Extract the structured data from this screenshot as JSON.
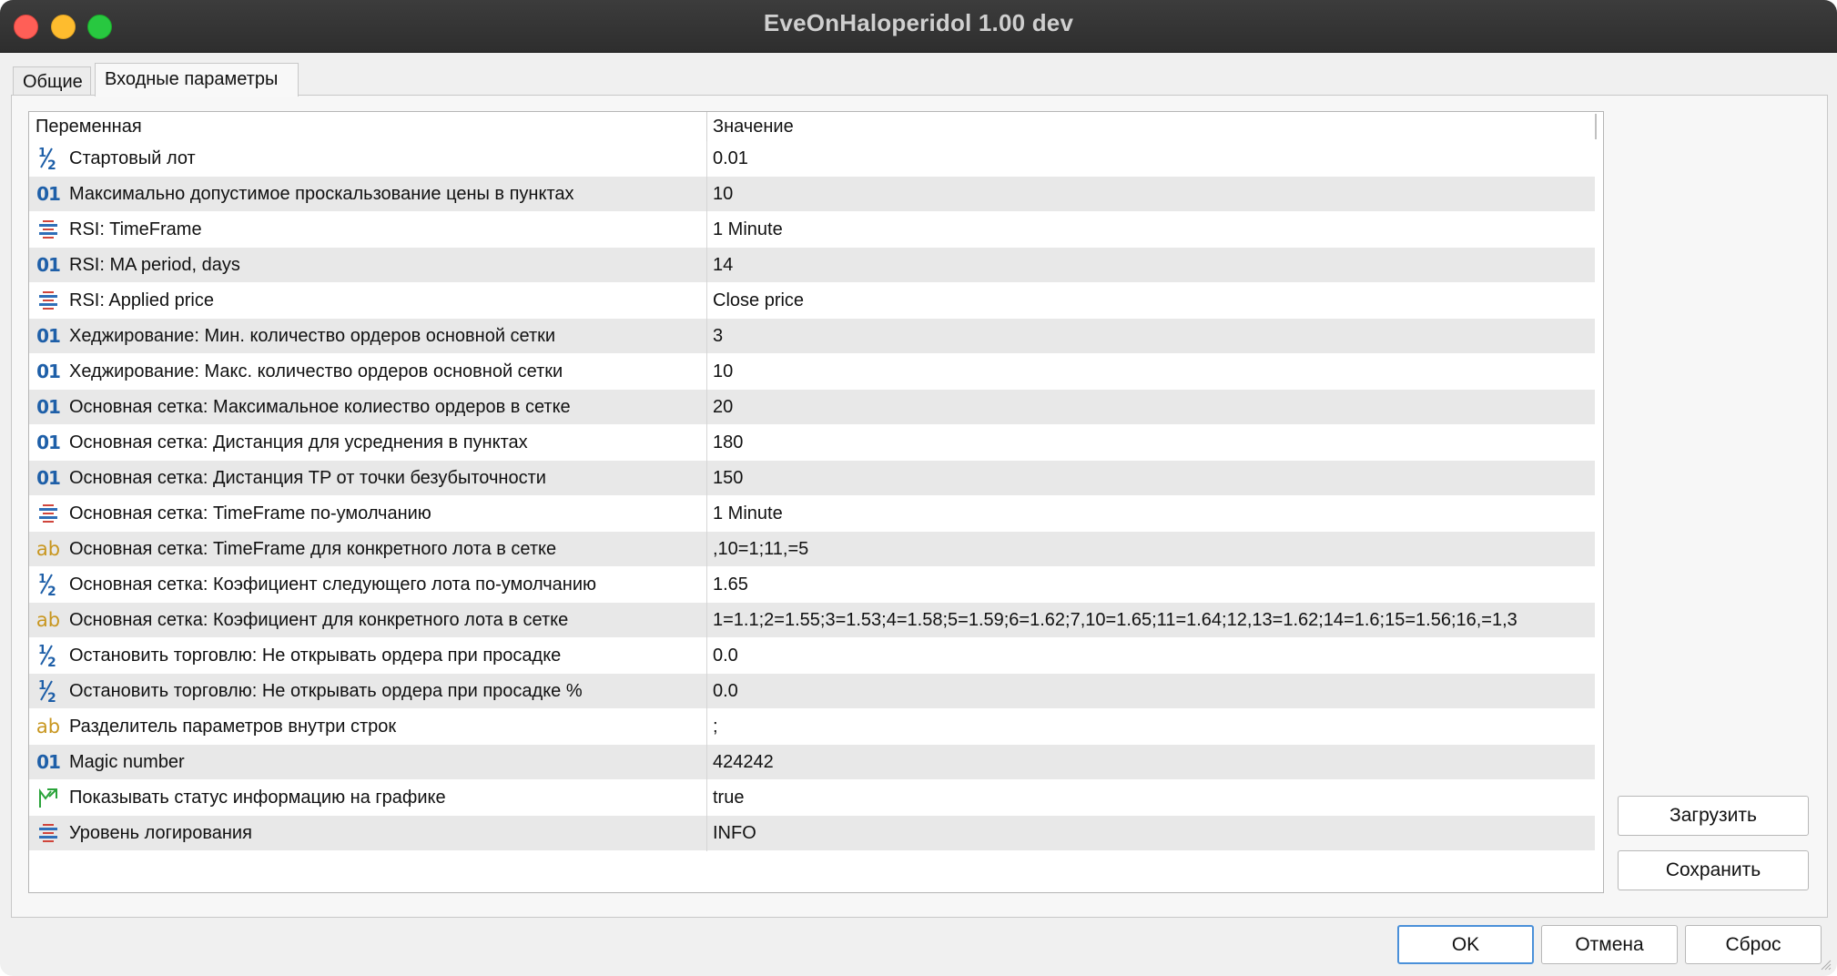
{
  "window": {
    "title": "EveOnHaloperidol 1.00 dev"
  },
  "tabs": [
    {
      "label": "Общие"
    },
    {
      "label": "Входные параметры"
    }
  ],
  "grid": {
    "header_variable": "Переменная",
    "header_value": "Значение",
    "rows": [
      {
        "icon": "fraction-icon",
        "name": "Стартовый лот",
        "value": "0.01"
      },
      {
        "icon": "integer-icon",
        "name": "Максимально допустимое проскальзование цены в пунктах",
        "value": "10"
      },
      {
        "icon": "enum-list-icon",
        "name": "RSI: TimeFrame",
        "value": "1 Minute"
      },
      {
        "icon": "integer-icon",
        "name": "RSI: MA period, days",
        "value": "14"
      },
      {
        "icon": "enum-list-icon",
        "name": "RSI: Applied price",
        "value": "Close price"
      },
      {
        "icon": "integer-icon",
        "name": "Хеджирование: Мин. количество ордеров основной сетки",
        "value": "3"
      },
      {
        "icon": "integer-icon",
        "name": "Хеджирование: Макс. количество ордеров основной сетки",
        "value": "10"
      },
      {
        "icon": "integer-icon",
        "name": "Основная сетка: Максимальное колиество ордеров в сетке",
        "value": "20"
      },
      {
        "icon": "integer-icon",
        "name": "Основная сетка: Дистанция для усреднения в пунктах",
        "value": "180"
      },
      {
        "icon": "integer-icon",
        "name": "Основная сетка: Дистанция TP от точки безубыточности",
        "value": "150"
      },
      {
        "icon": "enum-list-icon",
        "name": "Основная сетка: TimeFrame по-умолчанию",
        "value": "1 Minute"
      },
      {
        "icon": "string-icon",
        "name": "Основная сетка: TimeFrame для конкретного лота в сетке",
        "value": ",10=1;11,=5"
      },
      {
        "icon": "fraction-icon",
        "name": "Основная сетка: Коэфициент следующего лота по-умолчанию",
        "value": "1.65"
      },
      {
        "icon": "string-icon",
        "name": "Основная сетка: Коэфициент для конкретного лота в сетке",
        "value": "1=1.1;2=1.55;3=1.53;4=1.58;5=1.59;6=1.62;7,10=1.65;11=1.64;12,13=1.62;14=1.6;15=1.56;16,=1,3"
      },
      {
        "icon": "fraction-icon",
        "name": "Остановить торговлю: Не открывать ордера при просадке",
        "value": "0.0"
      },
      {
        "icon": "fraction-icon",
        "name": "Остановить торговлю: Не открывать ордера при просадке %",
        "value": "0.0"
      },
      {
        "icon": "string-icon",
        "name": "Разделитель параметров внутри строк",
        "value": ";"
      },
      {
        "icon": "integer-icon",
        "name": "Magic number",
        "value": "424242"
      },
      {
        "icon": "boolean-arrow-icon",
        "name": "Показывать статус информацию на графике",
        "value": "true"
      },
      {
        "icon": "enum-list-icon",
        "name": "Уровень логирования",
        "value": "INFO"
      }
    ]
  },
  "side_buttons": {
    "load": "Загрузить",
    "save": "Сохранить"
  },
  "bottom_buttons": {
    "ok": "OK",
    "cancel": "Отмена",
    "reset": "Сброс"
  },
  "icon_glyphs": {
    "integer-icon": "01",
    "string-icon": "ab"
  },
  "colors": {
    "integer_icon": "#1e5fa8",
    "string_icon": "#c8961e",
    "enum_icon_blue": "#2f6fb8",
    "enum_icon_red": "#d0453b",
    "boolean_icon": "#2aa33a",
    "ok_border": "#4a90d9"
  }
}
